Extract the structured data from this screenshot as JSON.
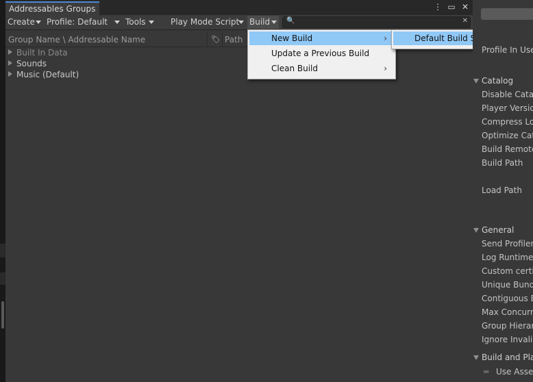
{
  "window": {
    "tab_title": "Addressables Groups",
    "icons": [
      "more-vert-icon",
      "maximize-icon",
      "close-icon"
    ]
  },
  "toolbar": {
    "create": "Create",
    "profile": "Profile: Default",
    "tools": "Tools",
    "play_mode_script": "Play Mode Script",
    "build": "Build",
    "search_placeholder": ""
  },
  "columns": {
    "group_name": "Group Name \\ Addressable Name",
    "path": "Path"
  },
  "groups": [
    {
      "label": "Built In Data",
      "dim": true
    },
    {
      "label": "Sounds",
      "dim": false
    },
    {
      "label": "Music (Default)",
      "dim": false
    }
  ],
  "build_menu": {
    "items": [
      {
        "label": "New Build",
        "has_submenu": true,
        "highlighted": true
      },
      {
        "label": "Update a Previous Build",
        "has_submenu": false,
        "highlighted": false
      },
      {
        "label": "Clean Build",
        "has_submenu": true,
        "highlighted": false
      }
    ]
  },
  "new_build_submenu": {
    "items": [
      {
        "label": "Default Build Script",
        "highlighted": true
      }
    ]
  },
  "inspector": {
    "profile_in_use": "Profile In Use",
    "catalog": {
      "header": "Catalog",
      "items": [
        "Disable Catal",
        "Player Versio",
        "Compress Loc",
        "Optimize Cata",
        "Build Remote",
        "Build Path",
        "Load Path"
      ]
    },
    "general": {
      "header": "General",
      "items": [
        "Send Profiler",
        "Log Runtime E",
        "Custom certif",
        "Unique Bundl",
        "Contiguous B",
        "Max Concurre",
        "Group Hierarc",
        "Ignore Invalid"
      ]
    },
    "build_and_play": {
      "header": "Build and Play",
      "items": [
        "Use Asset"
      ]
    }
  },
  "colors": {
    "highlight": "#90c8f6",
    "tab_accent": "#4a8ad6",
    "panel": "#383838"
  }
}
